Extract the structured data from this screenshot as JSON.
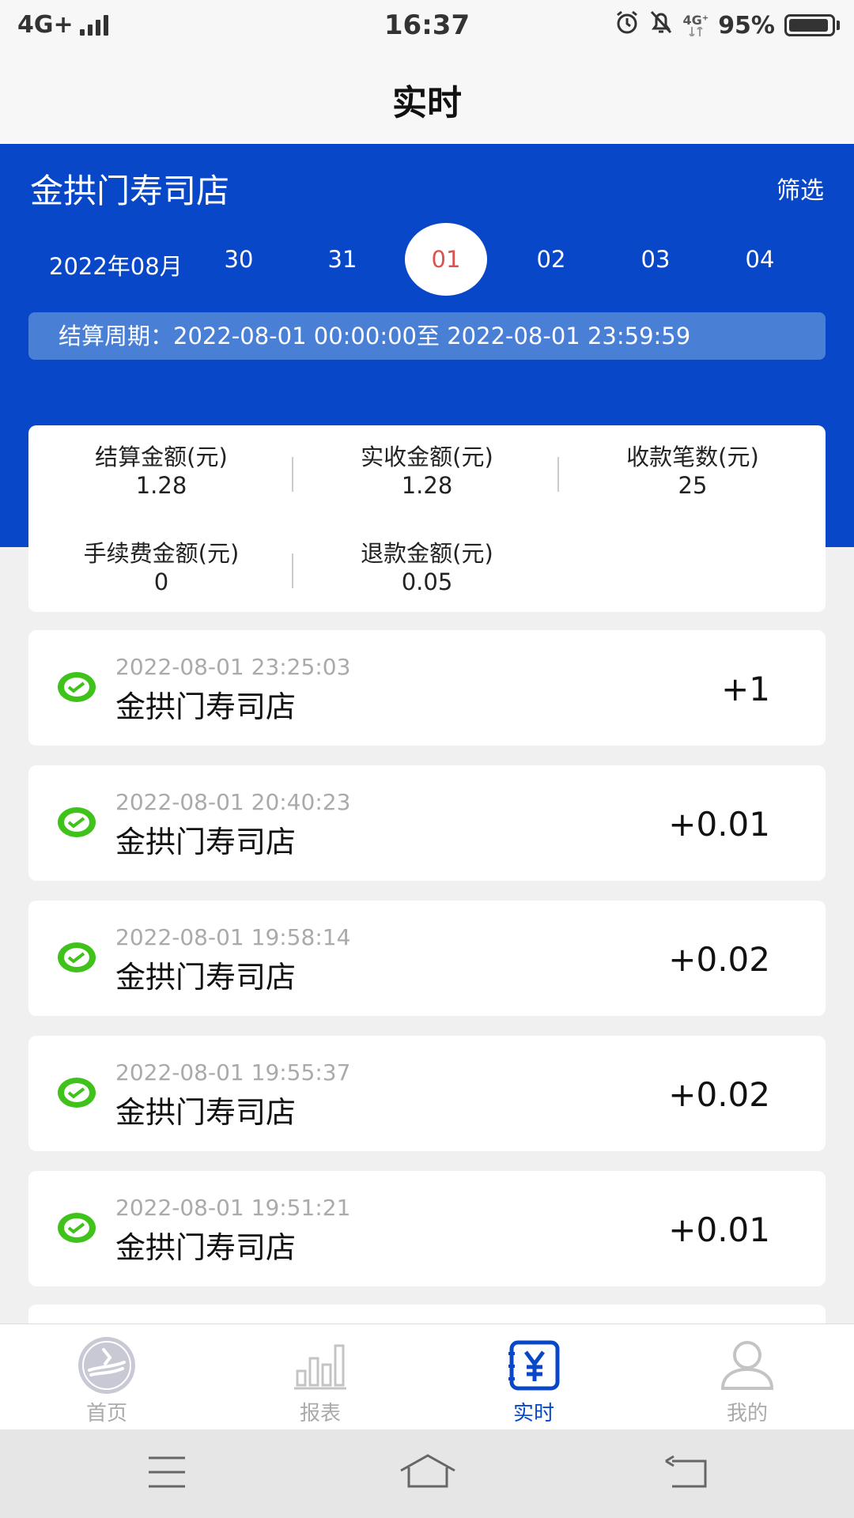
{
  "status_bar": {
    "network": "4G+",
    "time": "16:37",
    "net_small": "4G⁺",
    "battery": "95%",
    "battery_level": 0.95
  },
  "header": {
    "title": "实时"
  },
  "store": {
    "name": "金拱门寿司店",
    "filter_label": "筛选"
  },
  "date_bar": {
    "month": "2022年08月",
    "days": [
      {
        "label": "30",
        "selected": false
      },
      {
        "label": "31",
        "selected": false
      },
      {
        "label": "01",
        "selected": true
      },
      {
        "label": "02",
        "selected": false
      },
      {
        "label": "03",
        "selected": false
      },
      {
        "label": "04",
        "selected": false
      }
    ]
  },
  "settlement_period": "结算周期：2022-08-01 00:00:00至 2022-08-01 23:59:59",
  "summary": [
    {
      "label": "结算金额(元)",
      "value": "1.28"
    },
    {
      "label": "实收金额(元)",
      "value": "1.28"
    },
    {
      "label": "收款笔数(元)",
      "value": "25"
    },
    {
      "label": "手续费金额(元)",
      "value": "0"
    },
    {
      "label": "退款金额(元)",
      "value": "0.05"
    }
  ],
  "transactions": [
    {
      "time": "2022-08-01 23:25:03",
      "name": "金拱门寿司店",
      "amount": "+1",
      "icon": "wechat-pay-icon"
    },
    {
      "time": "2022-08-01 20:40:23",
      "name": "金拱门寿司店",
      "amount": "+0.01",
      "icon": "wechat-pay-icon"
    },
    {
      "time": "2022-08-01 19:58:14",
      "name": "金拱门寿司店",
      "amount": "+0.02",
      "icon": "wechat-pay-icon"
    },
    {
      "time": "2022-08-01 19:55:37",
      "name": "金拱门寿司店",
      "amount": "+0.02",
      "icon": "wechat-pay-icon"
    },
    {
      "time": "2022-08-01 19:51:21",
      "name": "金拱门寿司店",
      "amount": "+0.01",
      "icon": "wechat-pay-icon"
    }
  ],
  "tabs": [
    {
      "label": "首页",
      "icon": "home-logo-icon",
      "active": false
    },
    {
      "label": "报表",
      "icon": "bar-chart-icon",
      "active": false
    },
    {
      "label": "实时",
      "icon": "yuan-ledger-icon",
      "active": true
    },
    {
      "label": "我的",
      "icon": "user-icon",
      "active": false
    }
  ],
  "system_nav": {
    "icons": [
      "menu-icon",
      "home-icon",
      "back-icon"
    ]
  },
  "colors": {
    "brand_blue": "#0747c8",
    "selected_day": "#d9534f",
    "wechat_green": "#3fc21a"
  }
}
